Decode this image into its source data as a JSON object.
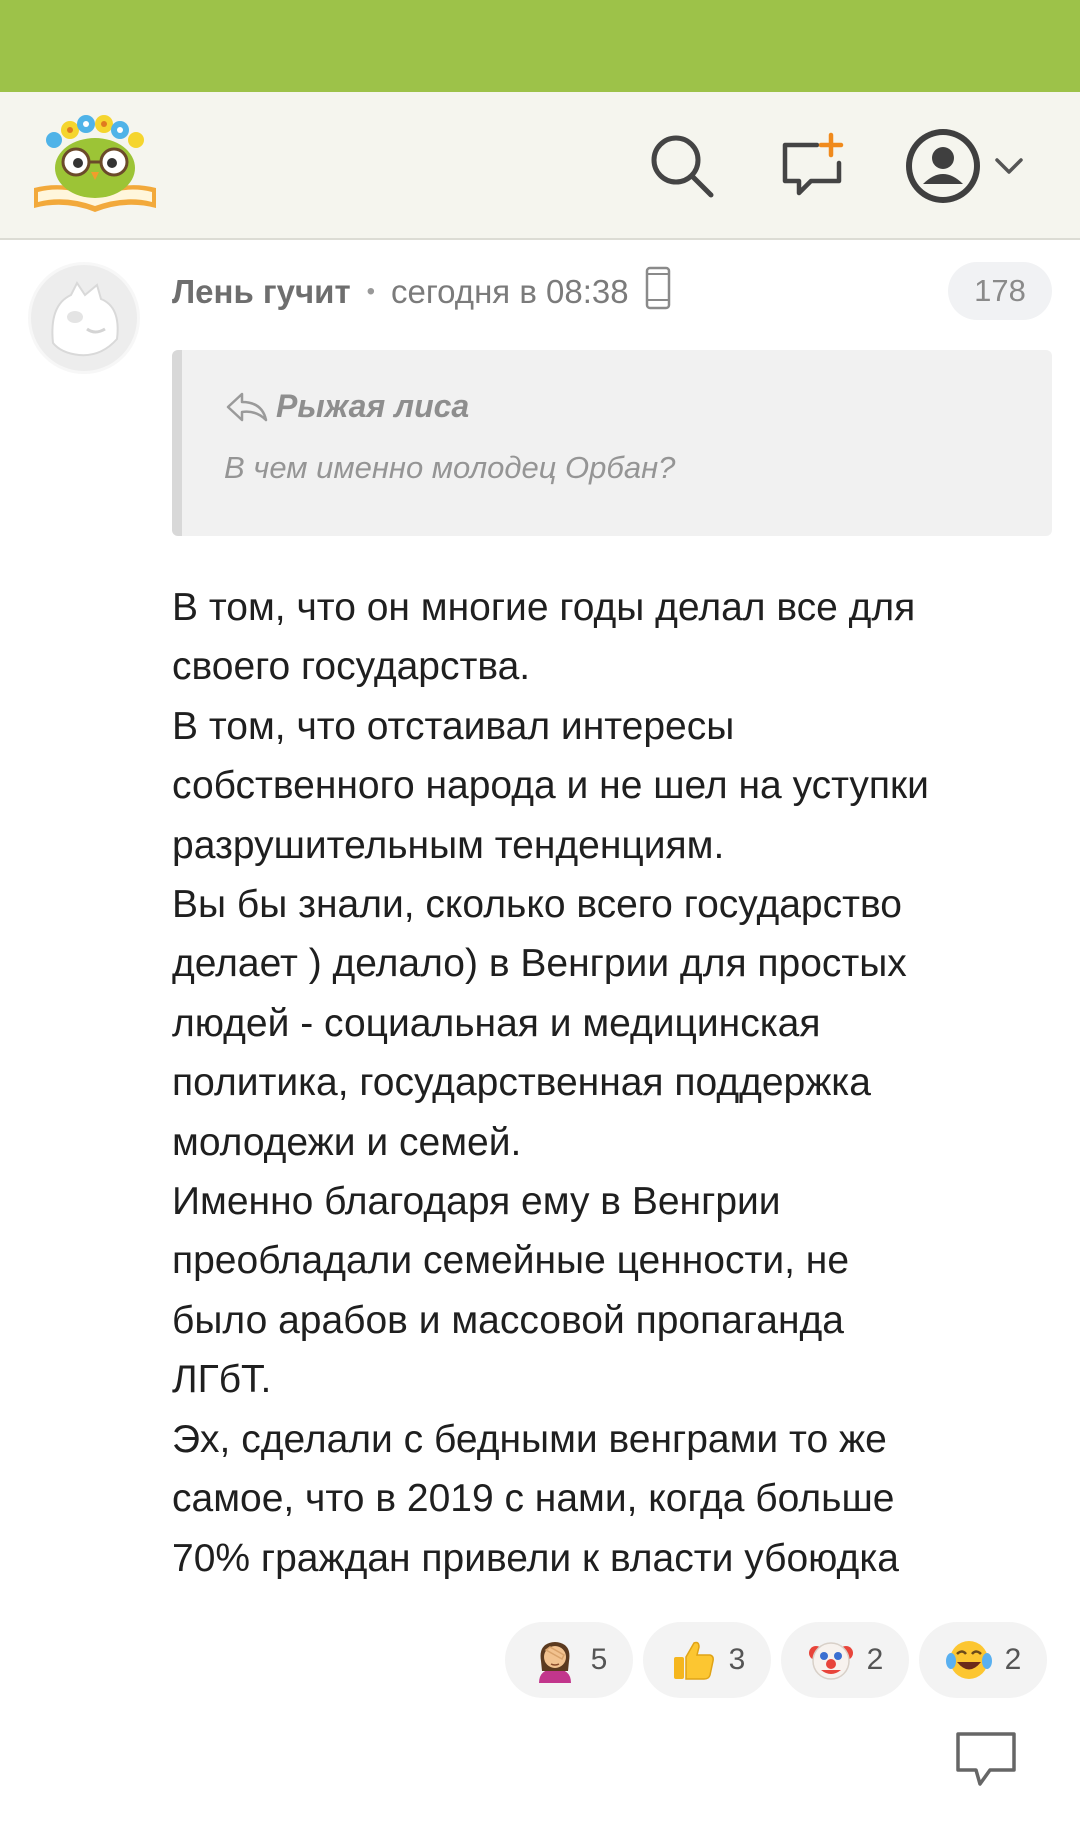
{
  "header": {
    "logo_icon": "owl-reading-book-logo",
    "search_icon": "search-icon",
    "new_message_icon": "new-message-icon",
    "profile_icon": "user-avatar-icon",
    "dropdown_icon": "chevron-down-icon"
  },
  "comment": {
    "author": "Лень гучит",
    "timestamp": "сегодня в 08:38",
    "device_icon": "mobile-phone-icon",
    "rating": "178",
    "quote": {
      "author": "Рыжая лиса",
      "text": "В чем именно молодец Орбан?"
    },
    "body_lines": [
      "В том, что он многие годы делал все для",
      "своего государства.",
      "В том, что отстаивал интересы",
      "собственного народа и не шел на уступки",
      "разрушительным тенденциям.",
      "Вы бы знали, сколько всего государство",
      "делает ) делало) в Венгрии для простых",
      "людей - социальная и медицинская",
      "политика, государственная поддержка",
      "молодежи и семей.",
      "Именно благодаря ему в Венгрии",
      "преобладали семейные ценности, не",
      "было арабов и массовой пропаганда",
      "ЛГбТ.",
      "Эх, сделали с бедными венграми то же",
      "самое, что в 2019 с нами, когда больше",
      "70% граждан привели к власти убоюдка"
    ],
    "reactions": [
      {
        "icon": "facepalm-emoji",
        "count": "5"
      },
      {
        "icon": "thumbs-up-emoji",
        "count": "3"
      },
      {
        "icon": "clown-emoji",
        "count": "2"
      },
      {
        "icon": "laughing-tears-emoji",
        "count": "2"
      }
    ],
    "reply_icon": "reply-bubble-icon"
  },
  "colors": {
    "status_bar": "#9dc249",
    "header_bg": "#f5f5ee",
    "quote_bg": "#f1f1f1"
  }
}
